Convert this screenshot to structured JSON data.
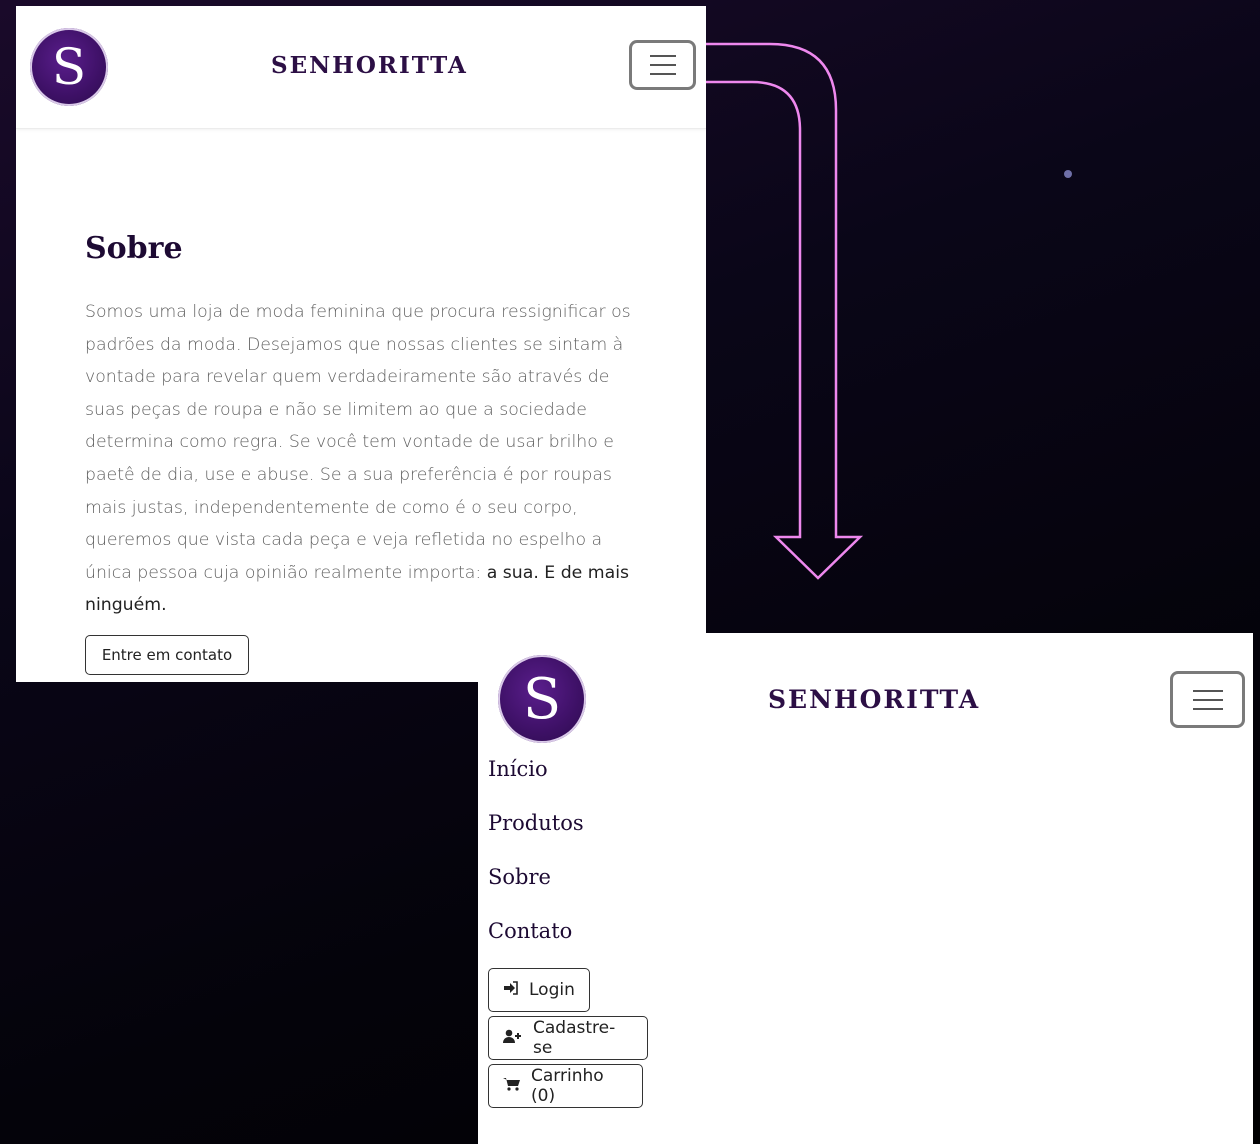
{
  "brand": {
    "logo_letter": "S",
    "name": "SENHORITTA",
    "primary_color": "#2c0f45",
    "logo_color": "#3f1168"
  },
  "about": {
    "title": "Sobre",
    "text": "Somos uma loja de moda feminina que procura ressignificar os padrões da moda. Desejamos que nossas clientes se sintam à vontade para revelar quem verdadeiramente são através de suas peças de roupa e não se limitem ao que a sociedade determina como regra. Se você tem vontade de usar brilho e paetê de dia, use e abuse. Se a sua preferência é por roupas mais justas, independentemente de como é o seu corpo, queremos que vista cada peça e veja refletida no espelho a única pessoa cuja opinião realmente importa: ",
    "emphasis": "a sua. E de mais ninguém.",
    "contact_button": "Entre em contato"
  },
  "menu": {
    "items": [
      "Início",
      "Produtos",
      "Sobre",
      "Contato"
    ],
    "login": "Login",
    "signup": "Cadastre-se",
    "cart": "Carrinho (0)",
    "icons": {
      "login": "sign-in-icon",
      "signup": "user-plus-icon",
      "cart": "cart-icon",
      "toggle": "hamburger-icon"
    }
  },
  "annotation": {
    "arrow_color": "#ee88ee"
  }
}
